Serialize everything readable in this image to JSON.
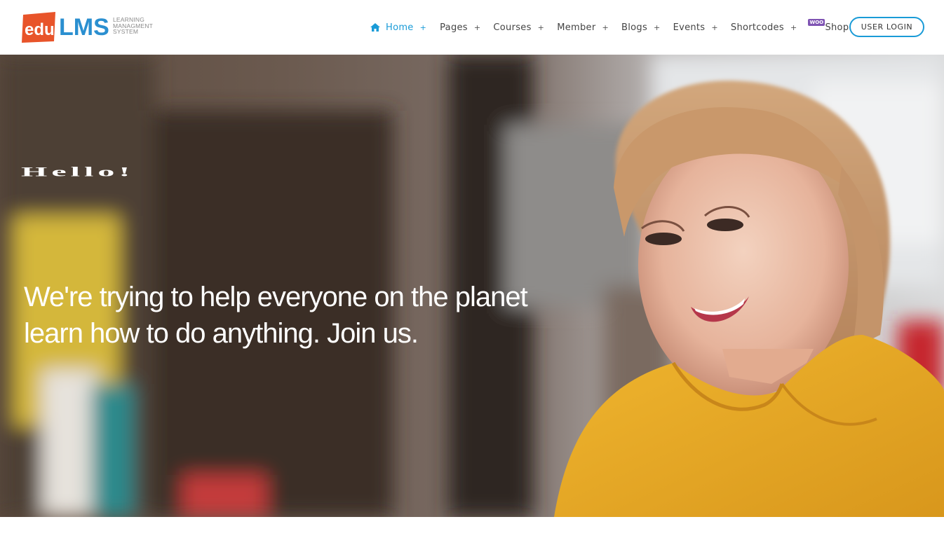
{
  "logo": {
    "badge_text": "edu",
    "brand": "LMS",
    "tagline": [
      "LEARNING",
      "MANAGMENT",
      "SYSTEM"
    ]
  },
  "nav": {
    "items": [
      {
        "label": "Home",
        "icon": "home-icon",
        "active": true
      },
      {
        "label": "Pages"
      },
      {
        "label": "Courses"
      },
      {
        "label": "Member"
      },
      {
        "label": "Blogs"
      },
      {
        "label": "Events"
      },
      {
        "label": "Shortcodes"
      },
      {
        "label": "Shop",
        "badge": "WOO"
      }
    ],
    "expand_symbol": "+",
    "login_label": "USER LOGIN"
  },
  "hero": {
    "greeting": "Hello!",
    "headline": "We're trying to help everyone on the planet learn how to do anything. Join us."
  },
  "colors": {
    "accent": "#1a9bd7",
    "logo_orange": "#e8542a",
    "logo_blue": "#2a8fd0",
    "hero_shirt": "#e8b02a"
  }
}
